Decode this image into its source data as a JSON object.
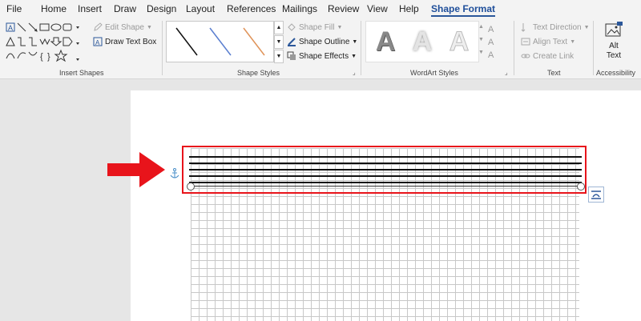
{
  "menu": {
    "tabs": [
      "File",
      "Home",
      "Insert",
      "Draw",
      "Design",
      "Layout",
      "References",
      "Mailings",
      "Review",
      "View",
      "Help",
      "Shape Format"
    ],
    "active": "Shape Format"
  },
  "ribbon": {
    "insert_shapes": {
      "label": "Insert Shapes",
      "edit_shape": "Edit Shape",
      "draw_text_box": "Draw Text Box"
    },
    "shape_styles": {
      "label": "Shape Styles",
      "shape_fill": "Shape Fill",
      "shape_outline": "Shape Outline",
      "shape_effects": "Shape Effects"
    },
    "wordart_styles": {
      "label": "WordArt Styles",
      "letters": [
        "A",
        "A",
        "A"
      ]
    },
    "text": {
      "label": "Text",
      "text_direction": "Text Direction",
      "align_text": "Align Text",
      "create_link": "Create Link"
    },
    "accessibility": {
      "label": "Accessibility",
      "alt_text_line1": "Alt",
      "alt_text_line2": "Text"
    }
  },
  "colors": {
    "accent": "#2b579a",
    "highlight": "#e8141b",
    "arrow": "#e8141b",
    "anchor": "#4a8fc8"
  }
}
